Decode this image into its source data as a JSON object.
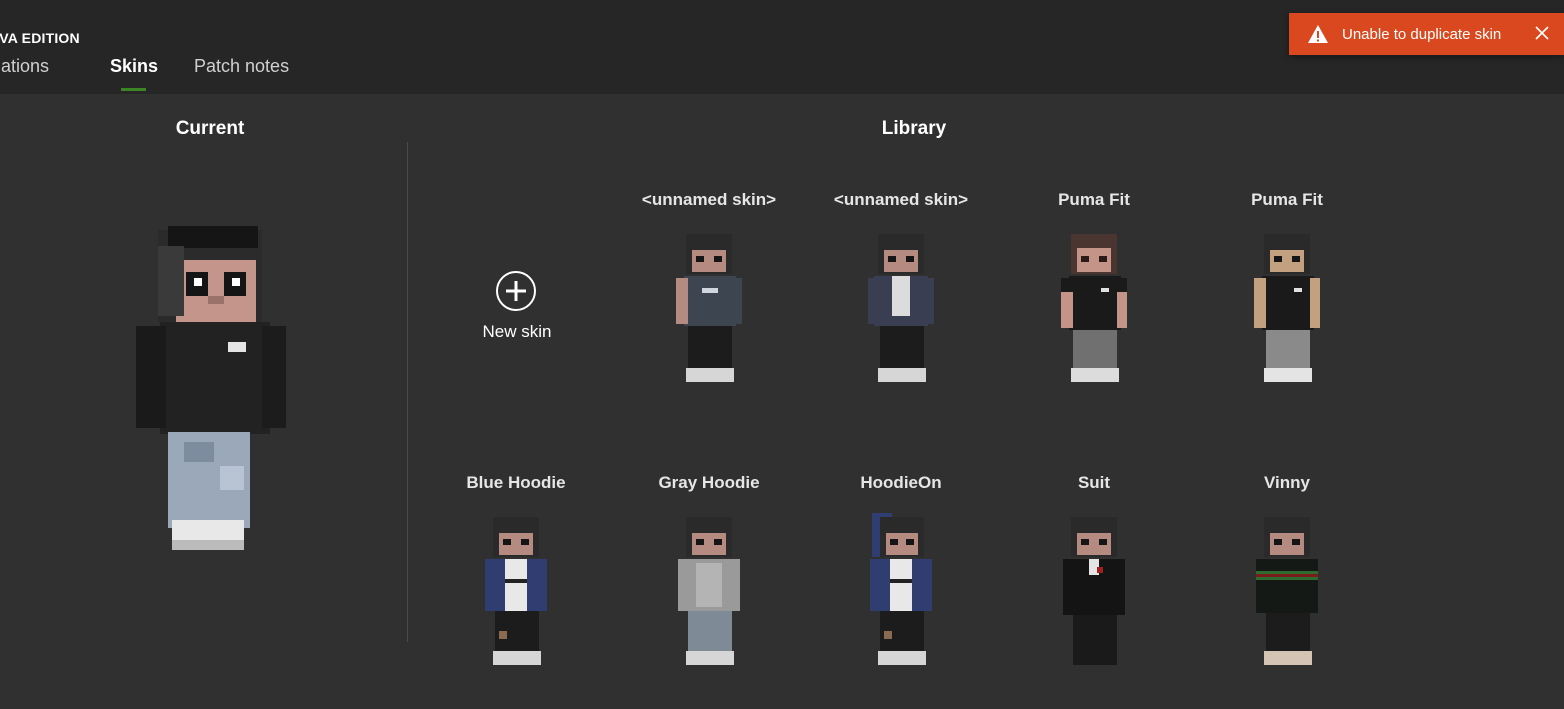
{
  "header": {
    "edition": "AVA EDITION",
    "tabs": [
      {
        "label": "tallations",
        "active": false
      },
      {
        "label": "Skins",
        "active": true
      },
      {
        "label": "Patch notes",
        "active": false
      }
    ]
  },
  "toast": {
    "message": "Unable to duplicate skin",
    "icon": "warning-icon",
    "close_icon": "close-icon",
    "color": "#d9481e"
  },
  "current": {
    "title": "Current"
  },
  "library": {
    "title": "Library",
    "new_skin_label": "New skin",
    "skins": [
      {
        "name": "<unnamed skin>"
      },
      {
        "name": "<unnamed skin>"
      },
      {
        "name": "Puma Fit"
      },
      {
        "name": "Puma Fit"
      },
      {
        "name": "Blue Hoodie"
      },
      {
        "name": "Gray Hoodie"
      },
      {
        "name": "HoodieOn"
      },
      {
        "name": "Suit"
      },
      {
        "name": "Vinny"
      }
    ]
  },
  "colors": {
    "accent": "#3c8527",
    "background": "#303030",
    "header": "#262626"
  }
}
